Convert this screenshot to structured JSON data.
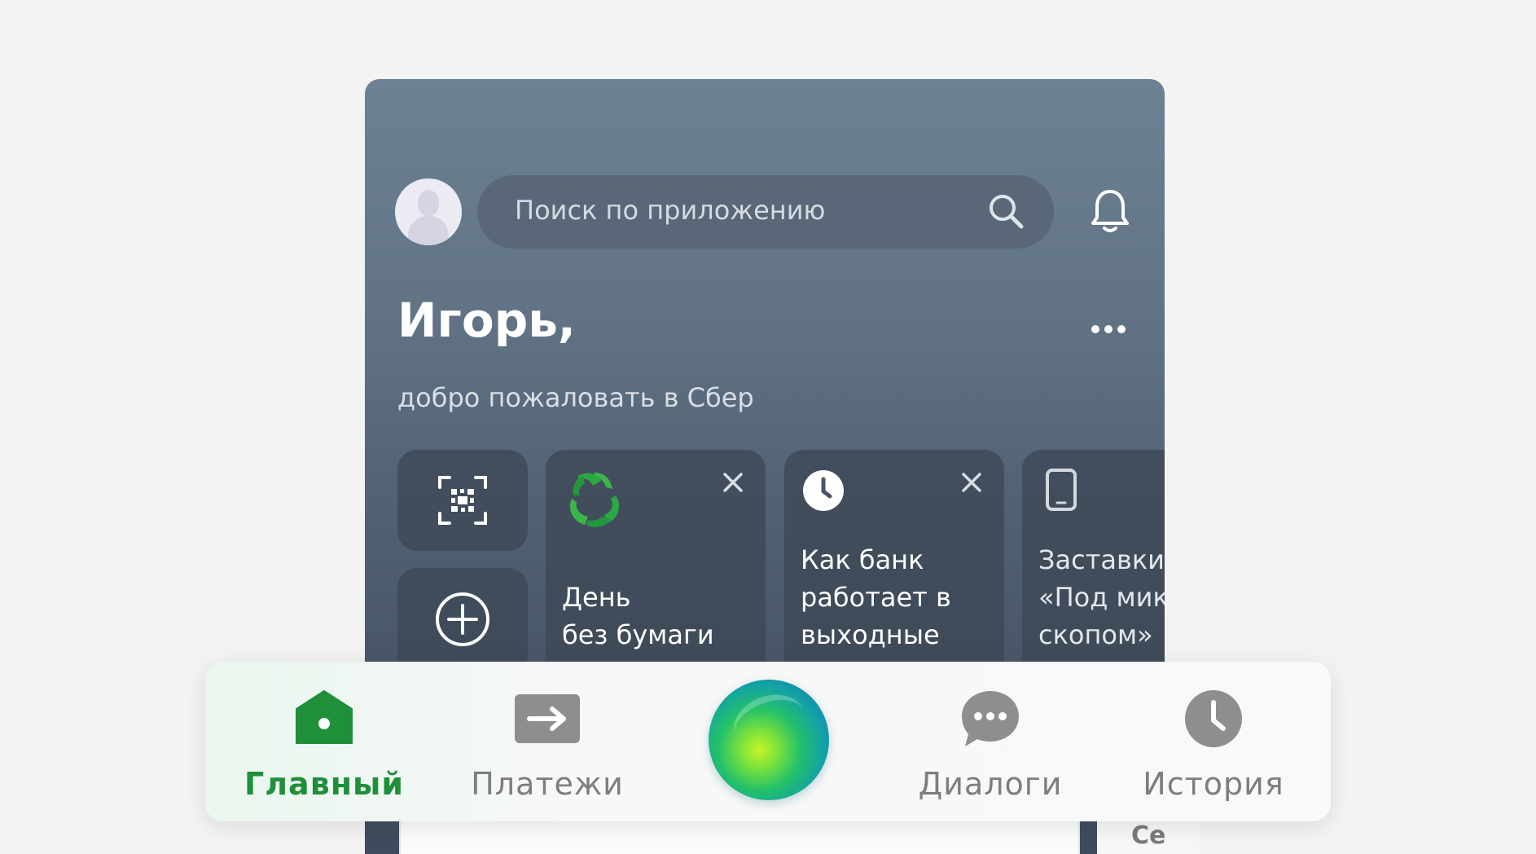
{
  "search": {
    "placeholder": "Поиск по приложению"
  },
  "greeting": {
    "name": "Игорь,",
    "subtitle": "добро пожаловать в Сбер"
  },
  "stories": [
    {
      "title": "День\nбез бумаги",
      "icon": "eco-recycle-icon"
    },
    {
      "title": "Как банк\nработает в\nвыходные",
      "icon": "clock-icon"
    },
    {
      "title": "Заставки\n«Под мик\nскопом»",
      "icon": "phone-icon"
    }
  ],
  "below": {
    "text": "Се"
  },
  "tabbar": {
    "tabs": [
      {
        "label": "Главный",
        "icon": "home-icon",
        "active": true
      },
      {
        "label": "Платежи",
        "icon": "payments-arrow-icon"
      },
      {
        "label": "Диалоги",
        "icon": "chat-bubble-icon"
      },
      {
        "label": "История",
        "icon": "history-clock-icon"
      }
    ]
  },
  "colors": {
    "accent": "#1f8f3a",
    "inactive": "#7d7d7d"
  }
}
